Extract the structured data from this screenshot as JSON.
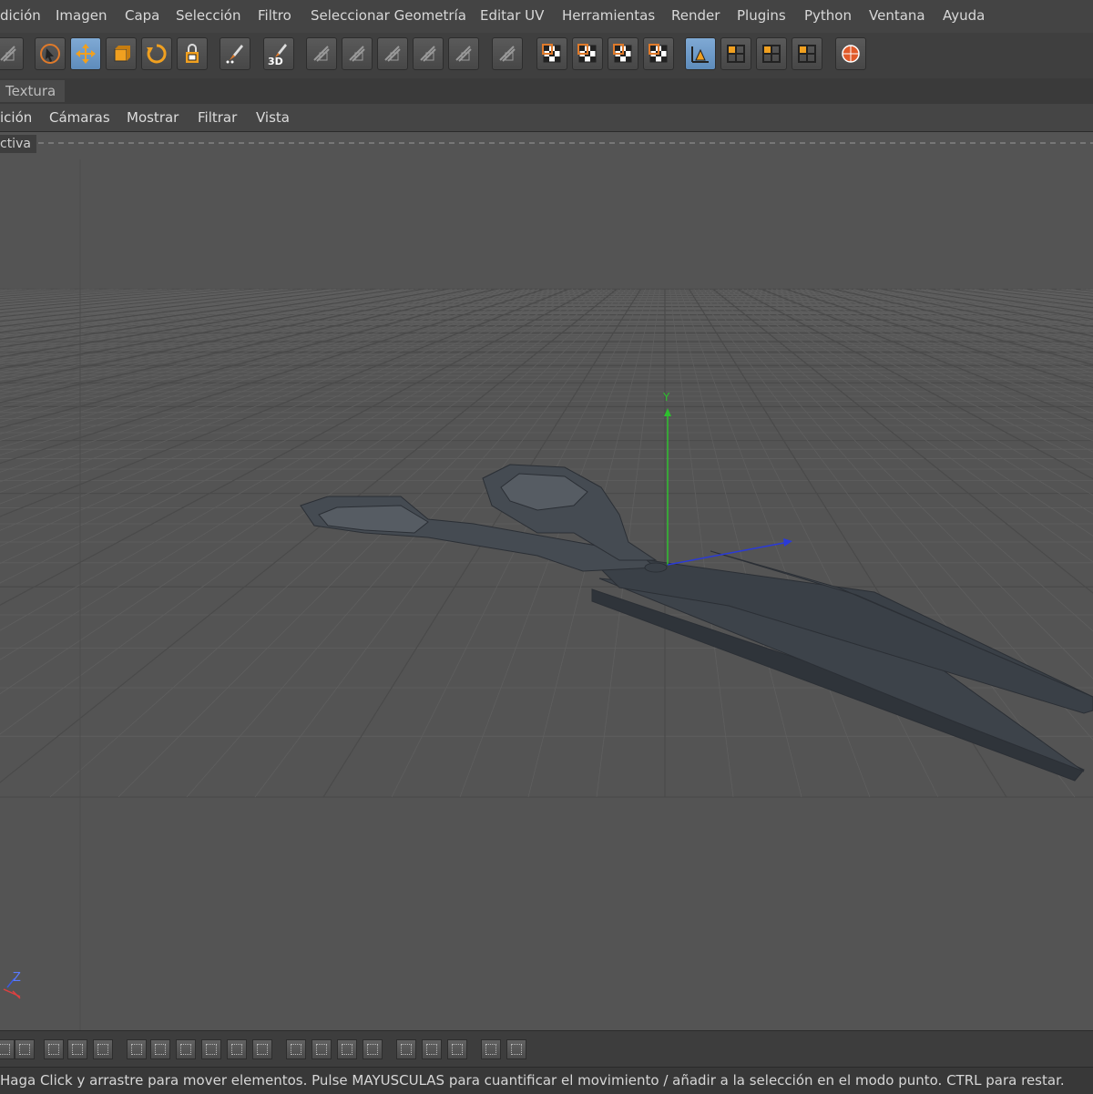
{
  "menu": {
    "items": [
      "dición",
      "Imagen",
      "Capa",
      "Selección",
      "Filtro",
      "Seleccionar Geometría",
      "Editar UV",
      "Herramientas",
      "Render",
      "Plugins",
      "Python",
      "Ventana",
      "Ayuda"
    ]
  },
  "toolbar": {
    "buttons": [
      {
        "name": "partial-tool-icon"
      },
      {
        "name": "live-selection-icon"
      },
      {
        "name": "move-icon",
        "active": true
      },
      {
        "name": "scale-icon"
      },
      {
        "name": "rotate-icon"
      },
      {
        "name": "lock-axis-icon"
      },
      {
        "name": "paint-brush-icon"
      },
      {
        "name": "paint-3d-icon",
        "label": "3D"
      },
      {
        "name": "uv-brush-1-icon"
      },
      {
        "name": "uv-brush-2-icon"
      },
      {
        "name": "uv-brush-3-icon"
      },
      {
        "name": "uv-brush-4-icon"
      },
      {
        "name": "uv-brush-5-icon"
      },
      {
        "name": "texture-view-icon"
      },
      {
        "name": "checker-1-icon"
      },
      {
        "name": "checker-2-icon"
      },
      {
        "name": "checker-3-icon"
      },
      {
        "name": "checker-4-icon"
      },
      {
        "name": "axis-mode-icon",
        "active": true
      },
      {
        "name": "layout-1-icon"
      },
      {
        "name": "layout-2-icon"
      },
      {
        "name": "layout-3-icon"
      },
      {
        "name": "render-sphere-icon"
      }
    ]
  },
  "tabs": {
    "active": "Textura"
  },
  "view_menu": {
    "items": [
      "ición",
      "Cámaras",
      "Mostrar",
      "Filtrar",
      "Vista"
    ]
  },
  "viewport": {
    "label": "ctiva",
    "gizmo": {
      "y_label": "Y"
    },
    "world_axis": {
      "z_label": "Z"
    },
    "colors": {
      "background": "#545454",
      "grid": "#5f5f5f",
      "object": "#3c4148",
      "y_axis": "#2ec02e",
      "z_axis": "#2a3ad8"
    }
  },
  "status": {
    "text": "Haga Click y arrastre para mover elementos. Pulse MAYUSCULAS para cuantificar el movimiento / añadir a la selección en el modo punto. CTRL para restar."
  }
}
